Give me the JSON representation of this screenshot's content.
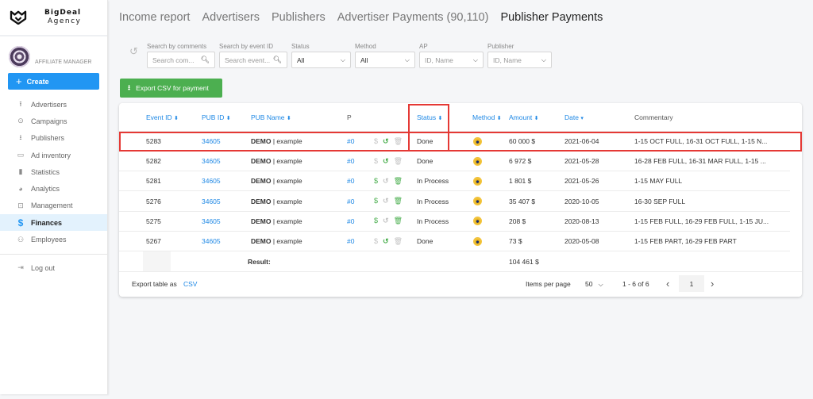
{
  "brand": {
    "name": "BigDeal",
    "sub": "Agency"
  },
  "profile": {
    "role": "AFFILIATE MANAGER"
  },
  "sidebar": {
    "create_label": "Create",
    "items": [
      {
        "label": "Advertisers",
        "icon": "upload-icon",
        "glyph": "⭱"
      },
      {
        "label": "Campaigns",
        "icon": "play-circle-icon",
        "glyph": "⊙"
      },
      {
        "label": "Publishers",
        "icon": "download-icon",
        "glyph": "⭳"
      },
      {
        "label": "Ad inventory",
        "icon": "window-icon",
        "glyph": "▭"
      },
      {
        "label": "Statistics",
        "icon": "bar-chart-icon",
        "glyph": "▮"
      },
      {
        "label": "Analytics",
        "icon": "pie-chart-icon",
        "glyph": "◕"
      },
      {
        "label": "Management",
        "icon": "settings-box-icon",
        "glyph": "⊡"
      },
      {
        "label": "Finances",
        "icon": "dollar-icon",
        "glyph": "$",
        "active": true
      },
      {
        "label": "Employees",
        "icon": "users-icon",
        "glyph": "⚇"
      }
    ],
    "logout_label": "Log out"
  },
  "tabs": [
    {
      "label": "Income report"
    },
    {
      "label": "Advertisers"
    },
    {
      "label": "Publishers"
    },
    {
      "label": "Advertiser Payments (90,110)"
    },
    {
      "label": "Publisher Payments",
      "active": true
    }
  ],
  "filters": {
    "comments": {
      "label": "Search by comments",
      "placeholder": "Search com..."
    },
    "event_id": {
      "label": "Search by event ID",
      "placeholder": "Search event..."
    },
    "status": {
      "label": "Status",
      "value": "All"
    },
    "method": {
      "label": "Method",
      "value": "All"
    },
    "ap": {
      "label": "AP",
      "placeholder": "ID, Name"
    },
    "publisher": {
      "label": "Publisher",
      "placeholder": "ID, Name"
    }
  },
  "export_button": "Export CSV for payment",
  "table": {
    "columns": {
      "event_id": "Event ID",
      "pub_id": "PUB ID",
      "pub_name": "PUB Name",
      "p": "P",
      "status": "Status",
      "method": "Method",
      "amount": "Amount",
      "date": "Date",
      "commentary": "Commentary"
    },
    "sort_icon": "⬍",
    "sort_desc_icon": "▾",
    "rows": [
      {
        "event_id": "5283",
        "pub_id": "34605",
        "pub_name_bold": "DEMO",
        "pub_name_rest": " | example",
        "p": "#0",
        "pay_active": false,
        "undo_active": true,
        "delete_active": false,
        "status": "Done",
        "amount": "60 000 $",
        "date": "2021-06-04",
        "commentary": "1-15 OCT FULL, 16-31 OCT FULL, 1-15 N..."
      },
      {
        "event_id": "5282",
        "pub_id": "34605",
        "pub_name_bold": "DEMO",
        "pub_name_rest": " | example",
        "p": "#0",
        "pay_active": false,
        "undo_active": true,
        "delete_active": false,
        "status": "Done",
        "amount": "6 972 $",
        "date": "2021-05-28",
        "commentary": "16-28 FEB FULL, 16-31 MAR FULL, 1-15 ..."
      },
      {
        "event_id": "5281",
        "pub_id": "34605",
        "pub_name_bold": "DEMO",
        "pub_name_rest": " | example",
        "p": "#0",
        "pay_active": true,
        "undo_active": false,
        "delete_active": true,
        "status": "In Process",
        "amount": "1 801 $",
        "date": "2021-05-26",
        "commentary": "1-15 MAY FULL"
      },
      {
        "event_id": "5276",
        "pub_id": "34605",
        "pub_name_bold": "DEMO",
        "pub_name_rest": " | example",
        "p": "#0",
        "pay_active": true,
        "undo_active": false,
        "delete_active": true,
        "status": "In Process",
        "amount": "35 407 $",
        "date": "2020-10-05",
        "commentary": "16-30 SEP FULL"
      },
      {
        "event_id": "5275",
        "pub_id": "34605",
        "pub_name_bold": "DEMO",
        "pub_name_rest": " | example",
        "p": "#0",
        "pay_active": true,
        "undo_active": false,
        "delete_active": true,
        "status": "In Process",
        "amount": "208 $",
        "date": "2020-08-13",
        "commentary": "1-15 FEB FULL, 16-29 FEB FULL, 1-15 JU..."
      },
      {
        "event_id": "5267",
        "pub_id": "34605",
        "pub_name_bold": "DEMO",
        "pub_name_rest": " | example",
        "p": "#0",
        "pay_active": false,
        "undo_active": true,
        "delete_active": false,
        "status": "Done",
        "amount": "73 $",
        "date": "2020-05-08",
        "commentary": "1-15 FEB PART, 16-29 FEB PART"
      }
    ],
    "total": {
      "label": "Result:",
      "amount": "104 461 $"
    }
  },
  "footer": {
    "export_label": "Export table as",
    "export_link": "CSV",
    "items_per_page_label": "Items per page",
    "items_per_page": "50",
    "range": "1 - 6 of 6",
    "page": "1"
  },
  "highlight_color": "#e53935",
  "accent_color": "#2196f3"
}
